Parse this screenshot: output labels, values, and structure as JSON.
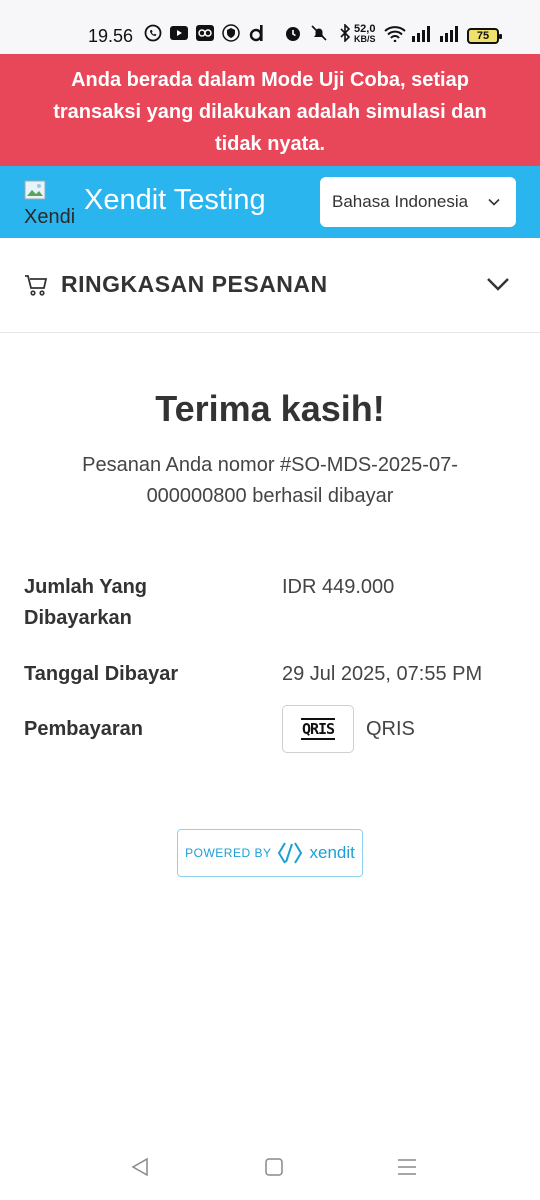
{
  "status_bar": {
    "time": "19.56",
    "net_speed_value": "52,0",
    "net_speed_unit": "KB/S",
    "battery": "75",
    "icons": [
      "whatsapp-icon",
      "youtube-icon",
      "app-icon",
      "vpn-icon",
      "d-app-icon",
      "alarm-icon",
      "mute-icon",
      "bluetooth-icon",
      "wifi-icon",
      "signal-icon",
      "signal-icon",
      "battery-icon"
    ]
  },
  "banner": {
    "text": "Anda berada dalam Mode Uji Coba, setiap transaksi yang dilakukan adalah simulasi dan tidak nyata."
  },
  "header": {
    "logo_alt": "Xendit",
    "brand": "Xendit Testing",
    "language": "Bahasa Indonesia"
  },
  "summary": {
    "title": "RINGKASAN PESANAN"
  },
  "main": {
    "thanks": "Terima kasih!",
    "order_message": "Pesanan Anda nomor #SO-MDS-2025-07-000000800 berhasil dibayar"
  },
  "details": {
    "amount_label": "Jumlah Yang Dibayarkan",
    "amount_value": "IDR 449.000",
    "date_label": "Tanggal Dibayar",
    "date_value": "29 Jul 2025, 07:55 PM",
    "payment_label": "Pembayaran",
    "payment_logo": "QRIS",
    "payment_value": "QRIS"
  },
  "footer": {
    "powered_by": "POWERED BY",
    "xendit": "xendit"
  },
  "colors": {
    "banner": "#e8475a",
    "header": "#2bb5ee",
    "accent": "#1d9fd6"
  }
}
